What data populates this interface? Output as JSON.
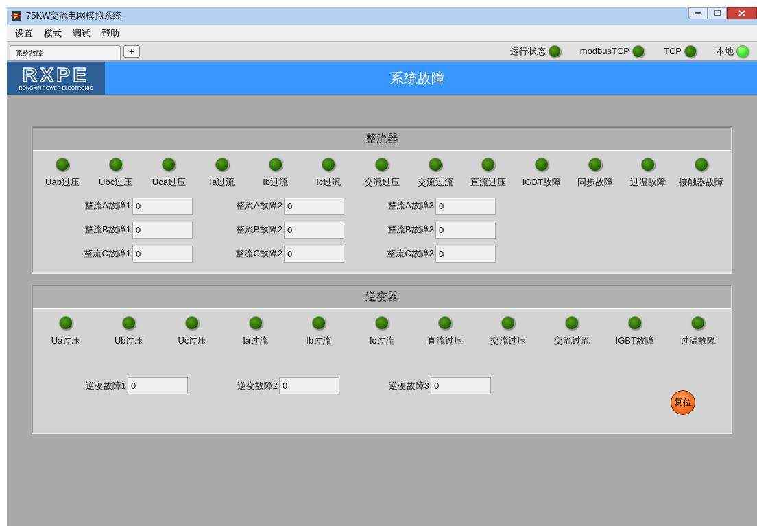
{
  "window": {
    "title": "75KW交流电网模拟系统"
  },
  "menu": [
    "设置",
    "模式",
    "调试",
    "帮助"
  ],
  "tabs": [
    {
      "label": "系统故障",
      "selected": true
    }
  ],
  "add_tab": "+",
  "status": [
    {
      "label": "运行状态",
      "on": false
    },
    {
      "label": "modbusTCP",
      "on": false
    },
    {
      "label": "TCP",
      "on": false
    },
    {
      "label": "本地",
      "on": true
    }
  ],
  "header": {
    "logo": "RXPE",
    "logo_sub": "RONGXIN POWER ELECTRONIC",
    "title": "系统故障"
  },
  "panels": [
    {
      "title": "整流器",
      "indicators": [
        {
          "label": "Uab过压",
          "on": false
        },
        {
          "label": "Ubc过压",
          "on": false
        },
        {
          "label": "Uca过压",
          "on": false
        },
        {
          "label": "Ia过流",
          "on": false
        },
        {
          "label": "Ib过流",
          "on": false
        },
        {
          "label": "Ic过流",
          "on": false
        },
        {
          "label": "交流过压",
          "on": false
        },
        {
          "label": "交流过流",
          "on": false
        },
        {
          "label": "直流过压",
          "on": false
        },
        {
          "label": "IGBT故障",
          "on": false
        },
        {
          "label": "同步故障",
          "on": false
        },
        {
          "label": "过温故障",
          "on": false
        },
        {
          "label": "接触器故障",
          "on": false
        }
      ],
      "fields": [
        {
          "label": "整流A故障1",
          "value": "0"
        },
        {
          "label": "整流A故障2",
          "value": "0"
        },
        {
          "label": "整流A故障3",
          "value": "0"
        },
        {
          "label": "整流B故障1",
          "value": "0"
        },
        {
          "label": "整流B故障2",
          "value": "0"
        },
        {
          "label": "整流B故障3",
          "value": "0"
        },
        {
          "label": "整流C故障1",
          "value": "0"
        },
        {
          "label": "整流C故障2",
          "value": "0"
        },
        {
          "label": "整流C故障3",
          "value": "0"
        }
      ]
    },
    {
      "title": "逆变器",
      "indicators": [
        {
          "label": "Ua过压",
          "on": false
        },
        {
          "label": "Ub过压",
          "on": false
        },
        {
          "label": "Uc过压",
          "on": false
        },
        {
          "label": "Ia过流",
          "on": false
        },
        {
          "label": "Ib过流",
          "on": false
        },
        {
          "label": "Ic过流",
          "on": false
        },
        {
          "label": "直流过压",
          "on": false
        },
        {
          "label": "交流过压",
          "on": false
        },
        {
          "label": "交流过流",
          "on": false
        },
        {
          "label": "IGBT故障",
          "on": false
        },
        {
          "label": "过温故障",
          "on": false
        }
      ],
      "fields": [
        {
          "label": "逆变故障1",
          "value": "0"
        },
        {
          "label": "逆变故障2",
          "value": "0"
        },
        {
          "label": "逆变故障3",
          "value": "0"
        }
      ],
      "reset_button": "复位"
    }
  ]
}
